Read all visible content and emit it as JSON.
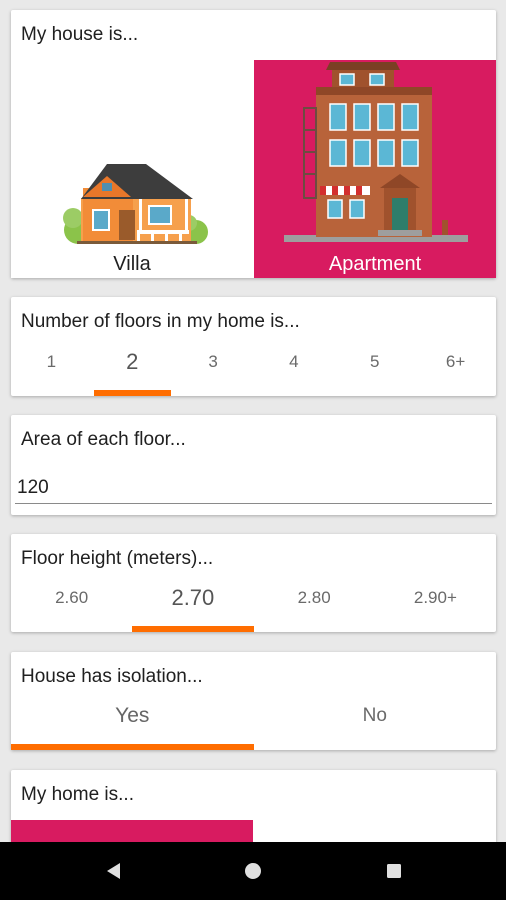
{
  "house_type": {
    "title": "My house is...",
    "options": [
      {
        "label": "Villa",
        "selected": false
      },
      {
        "label": "Apartment",
        "selected": true
      }
    ]
  },
  "floors": {
    "title": "Number of floors in my home is...",
    "options": [
      "1",
      "2",
      "3",
      "4",
      "5",
      "6+"
    ],
    "selected": "2"
  },
  "area": {
    "title": "Area of each floor...",
    "value": "120"
  },
  "floor_height": {
    "title": "Floor height (meters)...",
    "options": [
      "2.60",
      "2.70",
      "2.80",
      "2.90+"
    ],
    "selected": "2.70"
  },
  "isolation": {
    "title": "House has isolation...",
    "options": [
      "Yes",
      "No"
    ],
    "selected": "Yes"
  },
  "home": {
    "title": "My home is..."
  },
  "colors": {
    "accent": "#ff6d00",
    "selected_bg": "#d81b60",
    "background": "#e9e9e9"
  },
  "nav": {
    "icons": [
      "back-triangle-icon",
      "home-circle-icon",
      "recent-square-icon"
    ]
  }
}
